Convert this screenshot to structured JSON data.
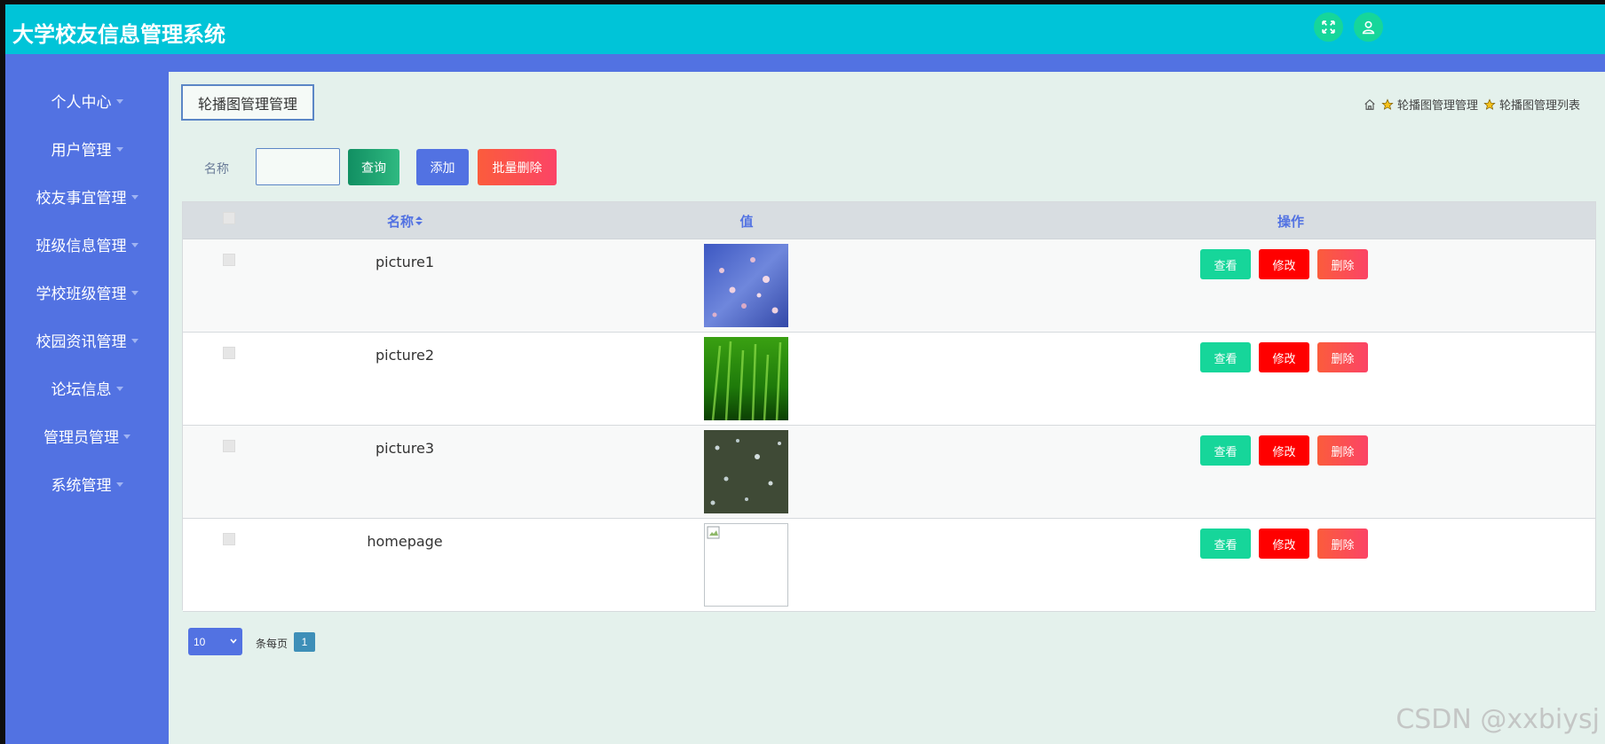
{
  "app": {
    "title": "大学校友信息管理系统"
  },
  "header": {
    "fullscreen_icon": "expand-icon",
    "user_icon": "user-icon"
  },
  "sidebar": {
    "items": [
      {
        "label": "个人中心"
      },
      {
        "label": "用户管理"
      },
      {
        "label": "校友事宜管理"
      },
      {
        "label": "班级信息管理"
      },
      {
        "label": "学校班级管理"
      },
      {
        "label": "校园资讯管理"
      },
      {
        "label": "论坛信息"
      },
      {
        "label": "管理员管理"
      },
      {
        "label": "系统管理"
      }
    ]
  },
  "page": {
    "title": "轮播图管理管理"
  },
  "breadcrumb": {
    "item1": "轮播图管理管理",
    "item2": "轮播图管理列表"
  },
  "search": {
    "label": "名称",
    "value": "",
    "query_label": "查询",
    "add_label": "添加",
    "batch_delete_label": "批量删除"
  },
  "table": {
    "columns": {
      "name": "名称",
      "value": "值",
      "actions": "操作"
    },
    "rows": [
      {
        "name": "picture1",
        "image": "blue-cherry-blossom-thumbnail"
      },
      {
        "name": "picture2",
        "image": "green-grass-thumbnail"
      },
      {
        "name": "picture3",
        "image": "dark-flowers-thumbnail"
      },
      {
        "name": "homepage",
        "image": "broken-image-thumbnail"
      }
    ],
    "view_label": "查看",
    "edit_label": "修改",
    "delete_label": "删除"
  },
  "pagination": {
    "page_size": "10",
    "per_page_label": "条每页",
    "current_page": "1"
  },
  "watermark": "CSDN @xxbiysj",
  "colors": {
    "header": "#00c4d8",
    "sidebar": "#5272e2",
    "view": "#16d69a",
    "edit": "#ff0000",
    "delete": "#fb4466"
  }
}
